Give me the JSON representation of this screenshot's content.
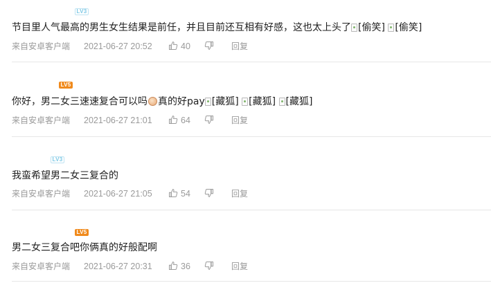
{
  "comments": [
    {
      "level": "LV3",
      "badge_style": "blue",
      "text_before": "节目里人气最高的男生女生结果是前任，并且目前还互相有好感，这也太上头了",
      "emojis": [
        "[偷笑]",
        "[偷笑]"
      ],
      "source": "来自安卓客户端",
      "time": "2021-06-27 20:52",
      "likes": "40",
      "reply": "回复"
    },
    {
      "level": "LV5",
      "badge_style": "orange",
      "text_before": "你好，男二女三速速复合可以吗",
      "text_after": "真的好pay",
      "emojis": [
        "[藏狐]",
        "[藏狐]",
        "[藏狐]"
      ],
      "source": "来自安卓客户端",
      "time": "2021-06-27 21:01",
      "likes": "64",
      "reply": "回复"
    },
    {
      "level": "LV3",
      "badge_style": "blue",
      "text": "我蛮希望男二女三复合的",
      "source": "来自安卓客户端",
      "time": "2021-06-27 21:05",
      "likes": "54",
      "reply": "回复"
    },
    {
      "level": "LV5",
      "badge_style": "orange",
      "text": "男二女三复合吧你俩真的好般配啊",
      "source": "来自安卓客户端",
      "time": "2021-06-27 20:31",
      "likes": "36",
      "reply": "回复"
    }
  ],
  "icons": {
    "like": "thumbs-up-icon",
    "dislike": "thumbs-down-icon",
    "broken_image": "broken-image-icon",
    "inline_emoji": "face-emoji-icon"
  },
  "colors": {
    "text": "#1f1f1f",
    "meta": "#9a9a9a",
    "divider": "#e6e6e6",
    "lv3": "#7ec9e6",
    "lv5": "#f08a1c"
  }
}
